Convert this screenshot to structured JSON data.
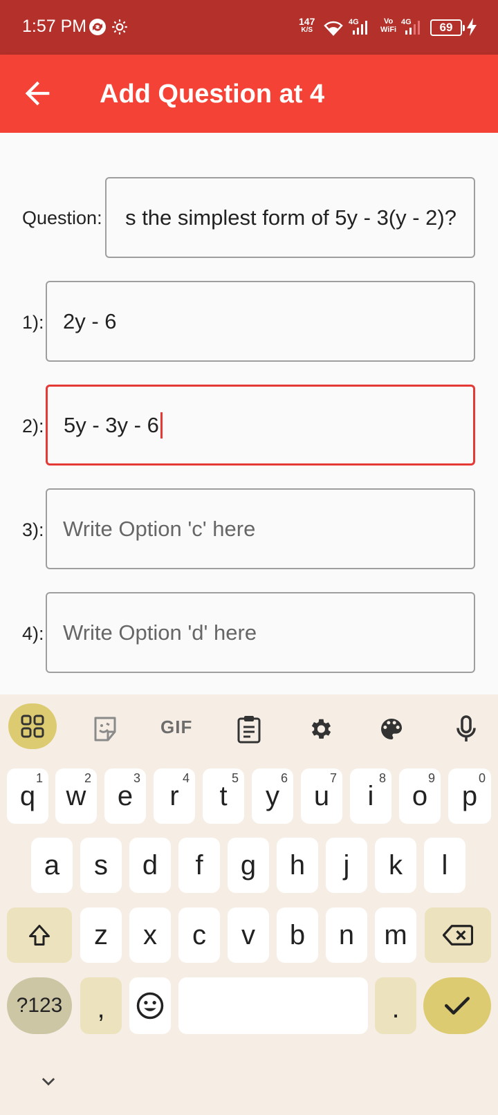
{
  "status_bar": {
    "time": "1:57 PM",
    "net_speed_value": "147",
    "net_speed_unit": "K/S",
    "network_1": "4G",
    "network_2_top": "Vo",
    "network_2_bottom": "WiFi",
    "network_3": "4G",
    "battery": "69"
  },
  "app_bar": {
    "title": "Add Question at 4"
  },
  "form": {
    "question_label": "Question:",
    "question_value": "s the simplest form of 5y - 3(y - 2)?",
    "options": [
      {
        "label": "1):",
        "value": "2y - 6",
        "placeholder": ""
      },
      {
        "label": "2):",
        "value": "5y - 3y - 6",
        "placeholder": ""
      },
      {
        "label": "3):",
        "value": "",
        "placeholder": "Write Option 'c' here"
      },
      {
        "label": "4):",
        "value": "",
        "placeholder": "Write Option 'd' here"
      }
    ]
  },
  "keyboard": {
    "toolbar_gif": "GIF",
    "row1": [
      "q",
      "w",
      "e",
      "r",
      "t",
      "y",
      "u",
      "i",
      "o",
      "p"
    ],
    "row1_hints": [
      "1",
      "2",
      "3",
      "4",
      "5",
      "6",
      "7",
      "8",
      "9",
      "0"
    ],
    "row2": [
      "a",
      "s",
      "d",
      "f",
      "g",
      "h",
      "j",
      "k",
      "l"
    ],
    "row3": [
      "z",
      "x",
      "c",
      "v",
      "b",
      "n",
      "m"
    ],
    "symbols_key": "?123",
    "comma_key": ",",
    "period_key": "."
  },
  "colors": {
    "status_bar": "#b3312a",
    "app_bar": "#f44336",
    "focus_border": "#e53935",
    "keyboard_bg": "#f6eee4",
    "accent_key": "#dccb70"
  }
}
